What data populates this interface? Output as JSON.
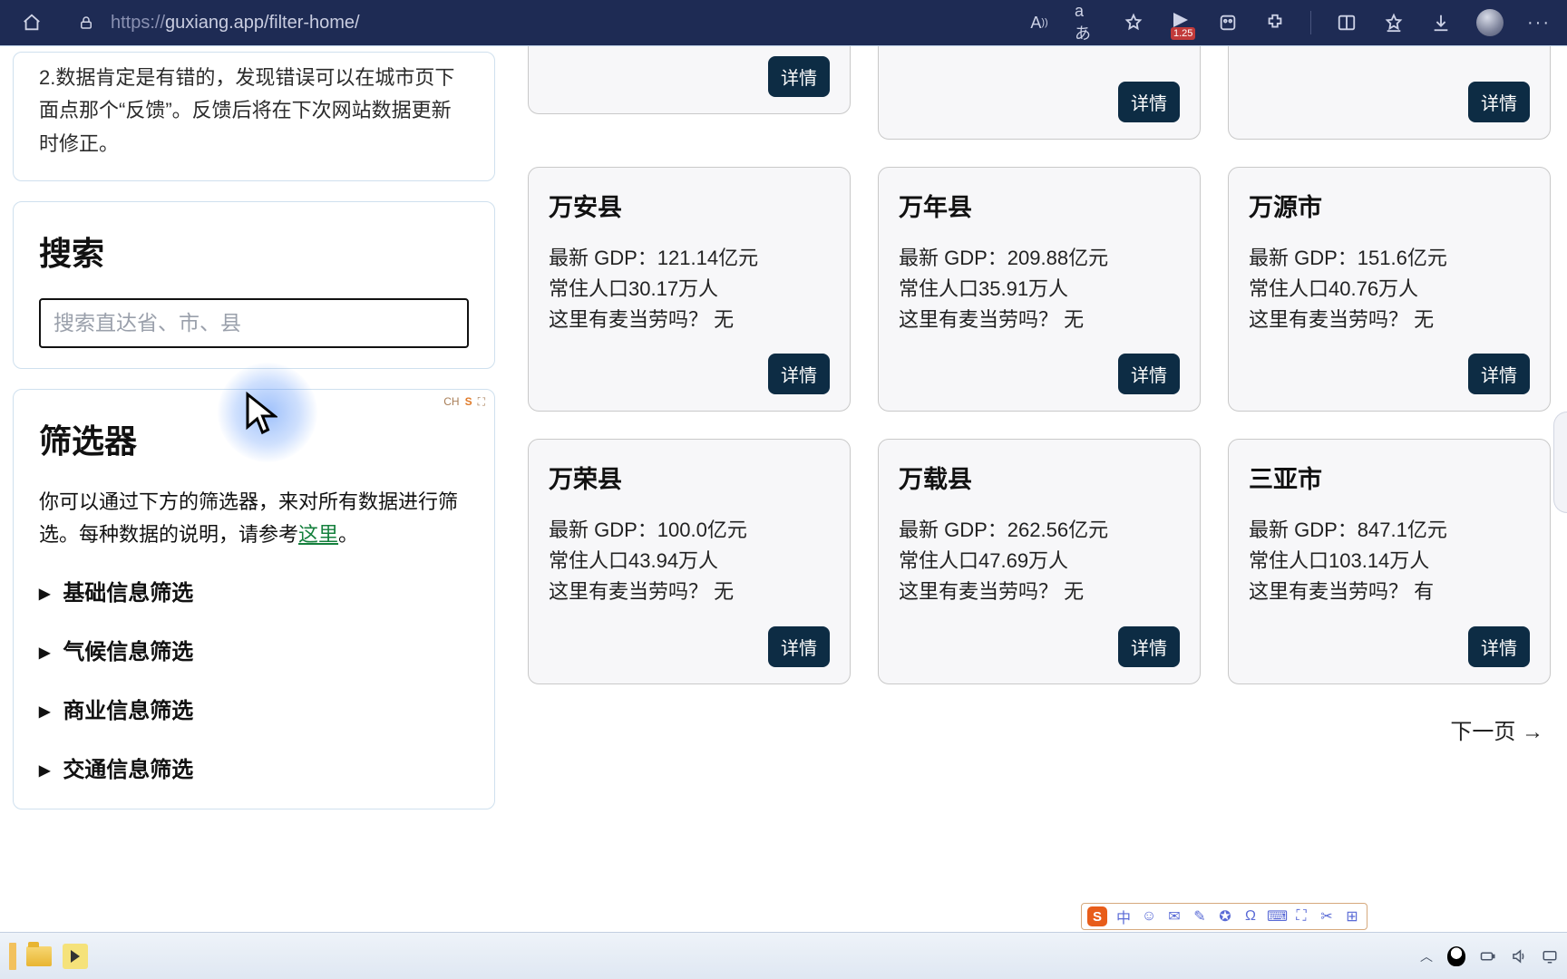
{
  "browser": {
    "url_protocol": "https://",
    "url_rest": "guxiang.app/filter-home/",
    "reading_icon_label": "A",
    "translate_icon_label": "aあ",
    "badge_value": "1.25"
  },
  "sidebar": {
    "note_text": "2.数据肯定是有错的，发现错误可以在城市页下面点那个“反馈”。反馈后将在下次网站数据更新时修正。",
    "search_heading": "搜索",
    "search_placeholder": "搜索直达省、市、县",
    "filter_heading": "筛选器",
    "filter_desc_pre": "你可以通过下方的筛选器，来对所有数据进行筛选。每种数据的说明，请参考",
    "filter_desc_link": "这里",
    "filter_desc_post": "。",
    "ime_hint": "CH",
    "groups": [
      {
        "label": "基础信息筛选"
      },
      {
        "label": "气候信息筛选"
      },
      {
        "label": "商业信息筛选"
      },
      {
        "label": "交通信息筛选"
      }
    ]
  },
  "labels": {
    "detail_button": "详情",
    "gdp_prefix": "最新 GDP：",
    "pop_prefix": "常住人口",
    "mcd_prefix": "这里有麦当劳吗？",
    "next_page": "下一页  →"
  },
  "cards": [
    {
      "name": "万安县",
      "gdp": "121.14亿元",
      "pop": "30.17万人",
      "mcd": "无"
    },
    {
      "name": "万年县",
      "gdp": "209.88亿元",
      "pop": "35.91万人",
      "mcd": "无"
    },
    {
      "name": "万源市",
      "gdp": "151.6亿元",
      "pop": "40.76万人",
      "mcd": "无"
    },
    {
      "name": "万荣县",
      "gdp": "100.0亿元",
      "pop": "43.94万人",
      "mcd": "无"
    },
    {
      "name": "万载县",
      "gdp": "262.56亿元",
      "pop": "47.69万人",
      "mcd": "无"
    },
    {
      "name": "三亚市",
      "gdp": "847.1亿元",
      "pop": "103.14万人",
      "mcd": "有"
    }
  ],
  "ime_toolbar": {
    "logo": "S",
    "items": [
      "中",
      "☺",
      "✉",
      "✎",
      "✪",
      "Ω",
      "⌨",
      "⛶",
      "✂",
      "⊞"
    ]
  }
}
